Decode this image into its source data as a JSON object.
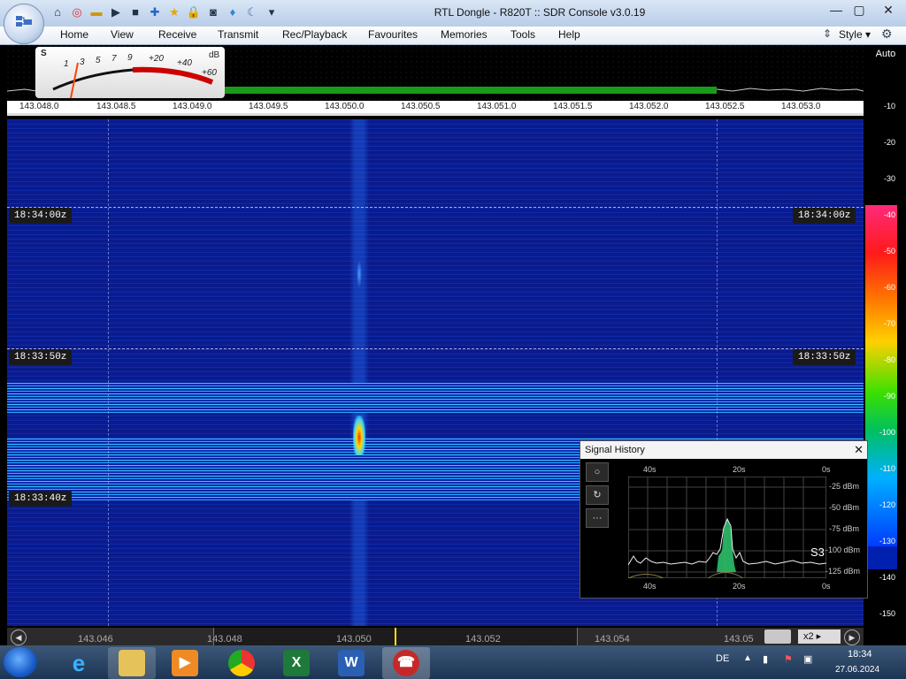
{
  "window": {
    "title": "RTL Dongle - R820T :: SDR Console v3.0.19",
    "quick_access_icons": [
      "home-icon",
      "lifebuoy-icon",
      "folder-icon",
      "play-icon",
      "stop-icon",
      "add-icon",
      "star-icon",
      "lock-icon",
      "camera-icon",
      "drop-icon",
      "moon-icon",
      "dropdown-icon"
    ]
  },
  "menu": {
    "items": [
      "Home",
      "View",
      "Receive",
      "Transmit",
      "Rec/Playback",
      "Favourites",
      "Memories",
      "Tools",
      "Help"
    ],
    "style_label": "Style"
  },
  "smeter": {
    "s_label": "S",
    "scale": [
      "1",
      "3",
      "5",
      "7",
      "9",
      "+20",
      "+40",
      "+60"
    ],
    "db_label": "dB"
  },
  "freq_ruler": [
    "143.048.0",
    "143.048.5",
    "143.049.0",
    "143.049.5",
    "143.050.0",
    "143.050.5",
    "143.051.0",
    "143.051.5",
    "143.052.0",
    "143.052.5",
    "143.053.0"
  ],
  "timestamps": [
    "18:34:00z",
    "18:33:50z",
    "18:33:40z"
  ],
  "scale_right": {
    "auto_label": "Auto",
    "ticks": [
      "-10",
      "-20",
      "-30",
      "-40",
      "-50",
      "-60",
      "-70",
      "-80",
      "-90",
      "-100",
      "-110",
      "-120",
      "-130",
      "-140",
      "-150"
    ]
  },
  "bottom_ruler": [
    "143.046",
    "143.048",
    "143.050",
    "143.052",
    "143.054",
    "143.05"
  ],
  "zoom": "x2",
  "signal_history": {
    "title": "Signal History",
    "top_axis": [
      "40s",
      "20s",
      "0s"
    ],
    "bottom_axis": [
      "40s",
      "20s",
      "0s"
    ],
    "db_levels": [
      "-25 dBm",
      "-50 dBm",
      "-75 dBm",
      "-100 dBm",
      "-125 dBm"
    ],
    "s_reading": "S3",
    "buttons": [
      "○",
      "↻",
      "···"
    ]
  },
  "taskbar": {
    "apps": [
      "ie-icon",
      "explorer-icon",
      "media-player-icon",
      "chrome-icon",
      "excel-icon",
      "word-icon",
      "sdr-console-icon"
    ],
    "language": "DE",
    "time": "18:34",
    "date": "27.06.2024"
  }
}
